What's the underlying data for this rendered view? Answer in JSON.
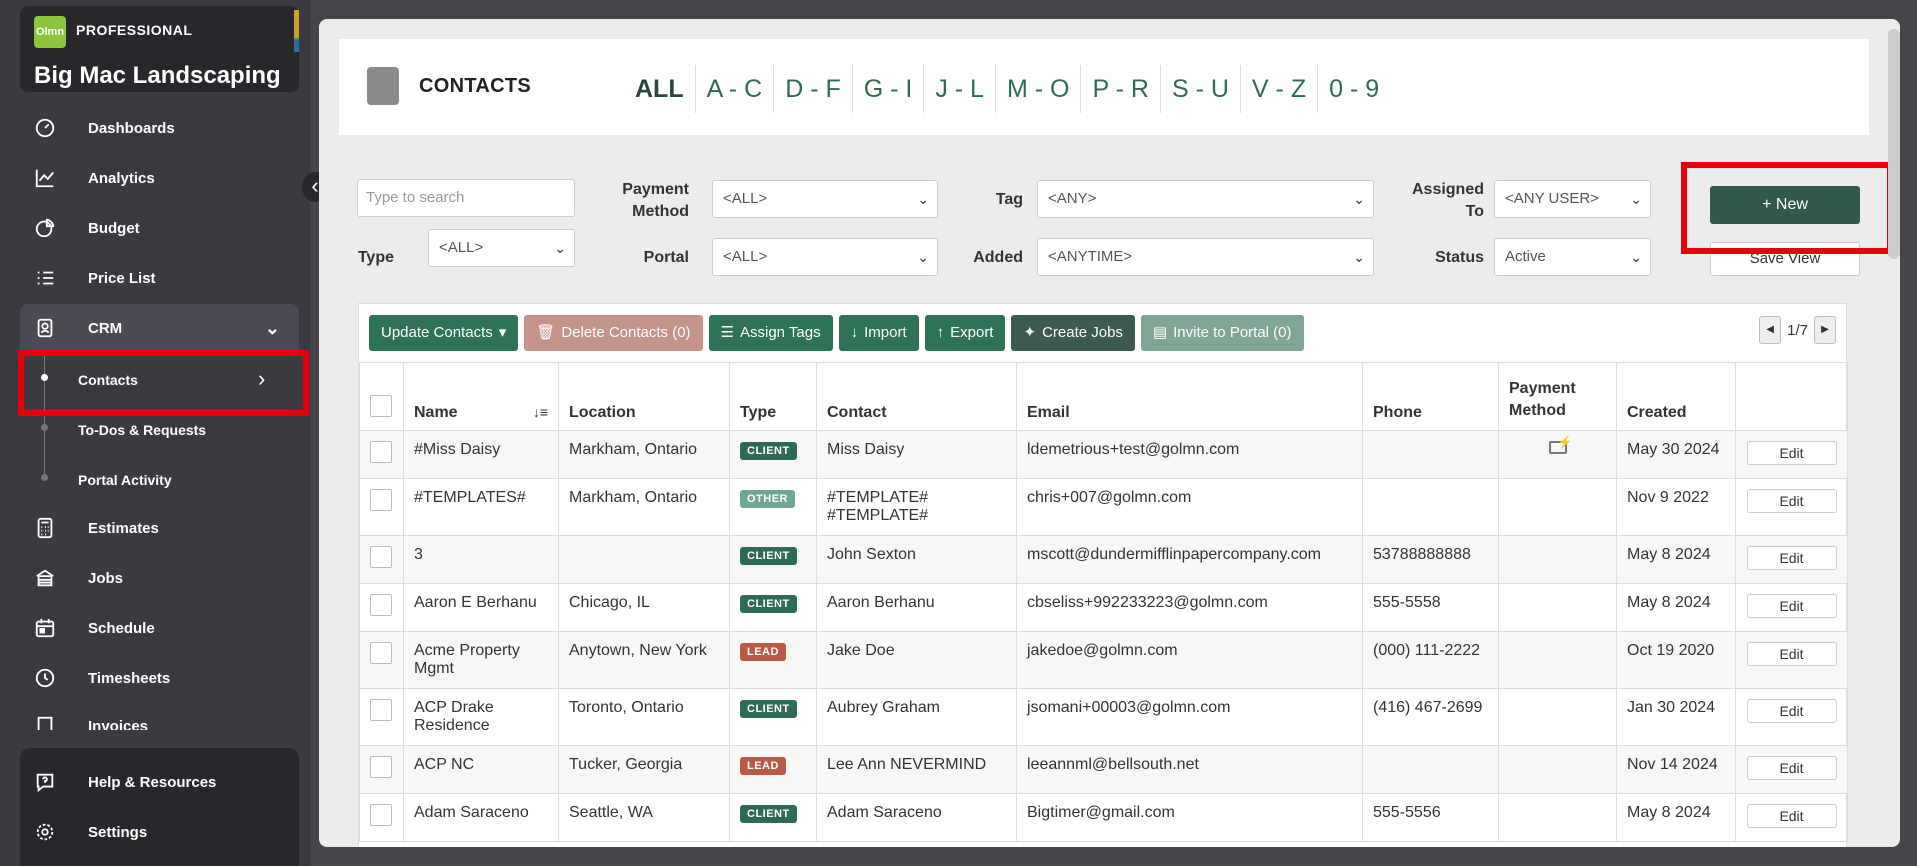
{
  "app": {
    "tier": "PROFESSIONAL",
    "logo_text": "Olmn",
    "company": "Big Mac Landscaping"
  },
  "sidebar": {
    "items": [
      {
        "label": "Dashboards",
        "icon": "dashboard-icon"
      },
      {
        "label": "Analytics",
        "icon": "analytics-icon"
      },
      {
        "label": "Budget",
        "icon": "pie-chart-icon"
      },
      {
        "label": "Price List",
        "icon": "list-icon"
      },
      {
        "label": "CRM",
        "icon": "contacts-card-icon"
      },
      {
        "label": "Estimates",
        "icon": "calculator-icon"
      },
      {
        "label": "Jobs",
        "icon": "jobs-icon"
      },
      {
        "label": "Schedule",
        "icon": "calendar-icon"
      },
      {
        "label": "Timesheets",
        "icon": "clock-icon"
      },
      {
        "label": "Invoices",
        "icon": "invoice-icon"
      }
    ],
    "crm_sub": [
      {
        "label": "Contacts"
      },
      {
        "label": "To-Dos & Requests"
      },
      {
        "label": "Portal Activity"
      }
    ],
    "bottom": [
      {
        "label": "Help & Resources",
        "icon": "help-icon"
      },
      {
        "label": "Settings",
        "icon": "gear-icon"
      }
    ]
  },
  "page": {
    "title": "CONTACTS",
    "letters": [
      "ALL",
      "A - C",
      "D - F",
      "G - I",
      "J - L",
      "M - O",
      "P - R",
      "S - U",
      "V - Z",
      "0 - 9"
    ]
  },
  "filters": {
    "search_placeholder": "Type to search",
    "type_label": "Type",
    "type_value": "<ALL>",
    "payment_label": "Payment Method",
    "payment_value": "<ALL>",
    "portal_label": "Portal",
    "portal_value": "<ALL>",
    "tag_label": "Tag",
    "tag_value": "<ANY>",
    "added_label": "Added",
    "added_value": "<ANYTIME>",
    "assigned_label": "Assigned To",
    "assigned_value": "<ANY USER>",
    "status_label": "Status",
    "status_value": "Active",
    "new_label": "New",
    "saveview_label": "Save View"
  },
  "toolbar": {
    "update": "Update Contacts",
    "delete": "Delete Contacts (0)",
    "assign_tags": "Assign Tags",
    "import": "Import",
    "export": "Export",
    "create_jobs": "Create Jobs",
    "invite": "Invite to Portal (0)",
    "pager": "1/7"
  },
  "table": {
    "columns": [
      "Name",
      "Location",
      "Type",
      "Contact",
      "Email",
      "Phone",
      "Payment Method",
      "Created"
    ],
    "edit_label": "Edit",
    "rows": [
      {
        "name": "#Miss Daisy",
        "location": "Markham, Ontario",
        "type": "CLIENT",
        "contact": "Miss Daisy",
        "email": "ldemetrious+test@golmn.com",
        "phone": "",
        "payment": "card-icon",
        "created": "May 30 2024"
      },
      {
        "name": "#TEMPLATES#",
        "location": "Markham, Ontario",
        "type": "OTHER",
        "contact": "#TEMPLATE# #TEMPLATE#",
        "email": "chris+007@golmn.com",
        "phone": "",
        "payment": "",
        "created": "Nov 9 2022"
      },
      {
        "name": "3",
        "location": "",
        "type": "CLIENT",
        "contact": "John Sexton",
        "email": "mscott@dundermifflinpapercompany.com",
        "phone": "53788888888",
        "payment": "",
        "created": "May 8 2024"
      },
      {
        "name": "Aaron E Berhanu",
        "location": "Chicago, IL",
        "type": "CLIENT",
        "contact": "Aaron Berhanu",
        "email": "cbseliss+992233223@golmn.com",
        "phone": "555-5558",
        "payment": "",
        "created": "May 8 2024"
      },
      {
        "name": "Acme Property Mgmt",
        "location": "Anytown, New York",
        "type": "LEAD",
        "contact": "Jake Doe",
        "email": "jakedoe@golmn.com",
        "phone": "(000) 111-2222",
        "payment": "",
        "created": "Oct 19 2020"
      },
      {
        "name": "ACP Drake Residence",
        "location": "Toronto, Ontario",
        "type": "CLIENT",
        "contact": "Aubrey Graham",
        "email": "jsomani+00003@golmn.com",
        "phone": "(416) 467-2699",
        "payment": "",
        "created": "Jan 30 2024"
      },
      {
        "name": "ACP NC",
        "location": "Tucker, Georgia",
        "type": "LEAD",
        "contact": "Lee Ann NEVERMIND",
        "email": "leeannml@bellsouth.net",
        "phone": "",
        "payment": "",
        "created": "Nov 14 2024"
      },
      {
        "name": "Adam Saraceno",
        "location": "Seattle, WA",
        "type": "CLIENT",
        "contact": "Adam Saraceno",
        "email": "Bigtimer@gmail.com",
        "phone": "555-5556",
        "payment": "",
        "created": "May 8 2024"
      }
    ]
  },
  "colors": {
    "client": "#2e6b55",
    "other": "#6ea890",
    "lead": "#b85a45",
    "highlight": "#e8000b"
  }
}
